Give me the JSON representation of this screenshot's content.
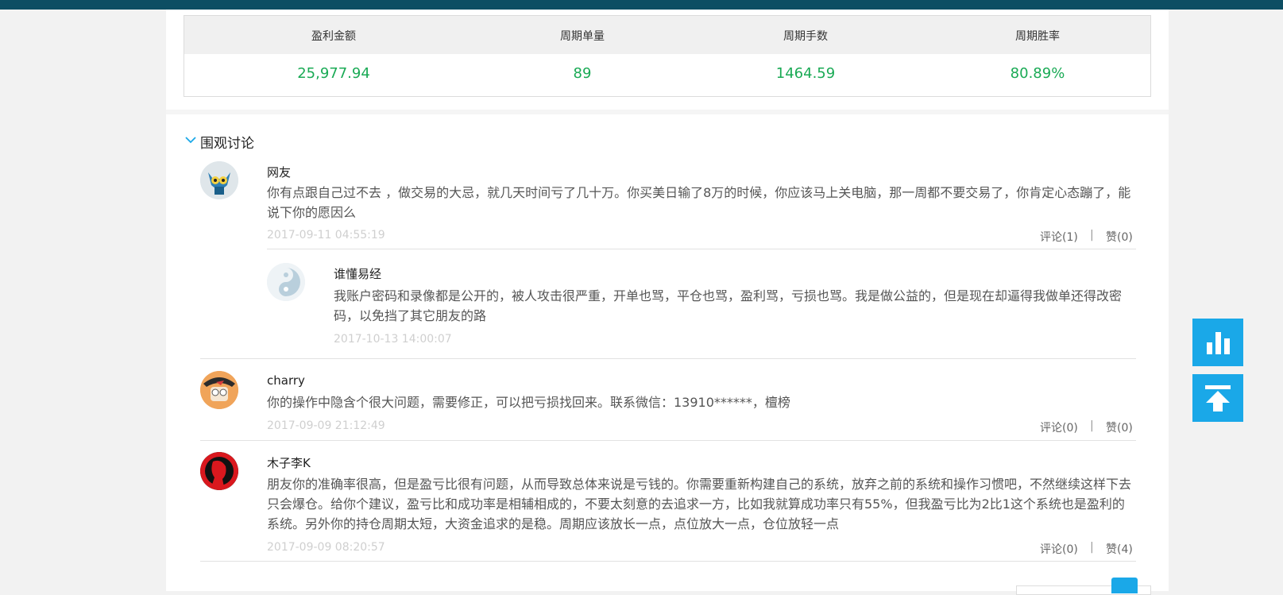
{
  "stats": {
    "items": [
      {
        "label": "盈利金额",
        "value": "25,977.94"
      },
      {
        "label": "周期单量",
        "value": "89"
      },
      {
        "label": "周期手数",
        "value": "1464.59"
      },
      {
        "label": "周期胜率",
        "value": "80.89%"
      }
    ],
    "value_color": "#1aaa55"
  },
  "discussion": {
    "title": "围观讨论",
    "comments": [
      {
        "name": "网友",
        "text": "你有点跟自己过不去 ，做交易的大忌，就几天时间亏了几十万。你买美日输了8万的时候，你应该马上关电脑，那一周都不要交易了，你肯定心态蹦了，能说下你的愿因么",
        "date": "2017-09-11 04:55:19",
        "comment_label": "评论(1)",
        "separator": "|",
        "like_label": "赞(0)",
        "avatar_icon": "owl-avatar-icon",
        "reply": {
          "name": "谁懂易经",
          "text": "我账户密码和录像都是公开的，被人攻击很严重，开单也骂，平仓也骂，盈利骂，亏损也骂。我是做公益的，但是现在却逼得我做单还得改密码，以免挡了其它朋友的路",
          "date": "2017-10-13 14:00:07",
          "avatar_icon": "yin-yang-avatar-icon"
        }
      },
      {
        "name": "charry",
        "text": "你的操作中隐含个很大问题，需要修正，可以把亏损找回来。联系微信：13910******，檀榜",
        "date": "2017-09-09 21:12:49",
        "comment_label": "评论(0)",
        "separator": "|",
        "like_label": "赞(0)",
        "avatar_icon": "cartoon-face-avatar-icon"
      },
      {
        "name": "木子李K",
        "text": "朋友你的准确率很高，但是盈亏比很有问题，从而导致总体来说是亏钱的。你需要重新构建自己的系统，放弃之前的系统和操作习惯吧，不然继续这样下去只会爆仓。给你个建议，盈亏比和成功率是相辅相成的，不要太刻意的去追求一方，比如我就算成功率只有55%，但我盈亏比为2比1这个系统也是盈利的系统。另外你的持仓周期太短，大资金追求的是稳。周期应该放长一点，点位放大一点，仓位放轻一点",
        "date": "2017-09-09 08:20:57",
        "comment_label": "评论(0)",
        "separator": "|",
        "like_label": "赞(4)",
        "avatar_icon": "red-silhouette-avatar-icon"
      }
    ]
  },
  "side_buttons": {
    "chart_icon": "bar-chart-icon",
    "top_icon": "back-to-top-icon",
    "color": "#1aa8e8"
  }
}
